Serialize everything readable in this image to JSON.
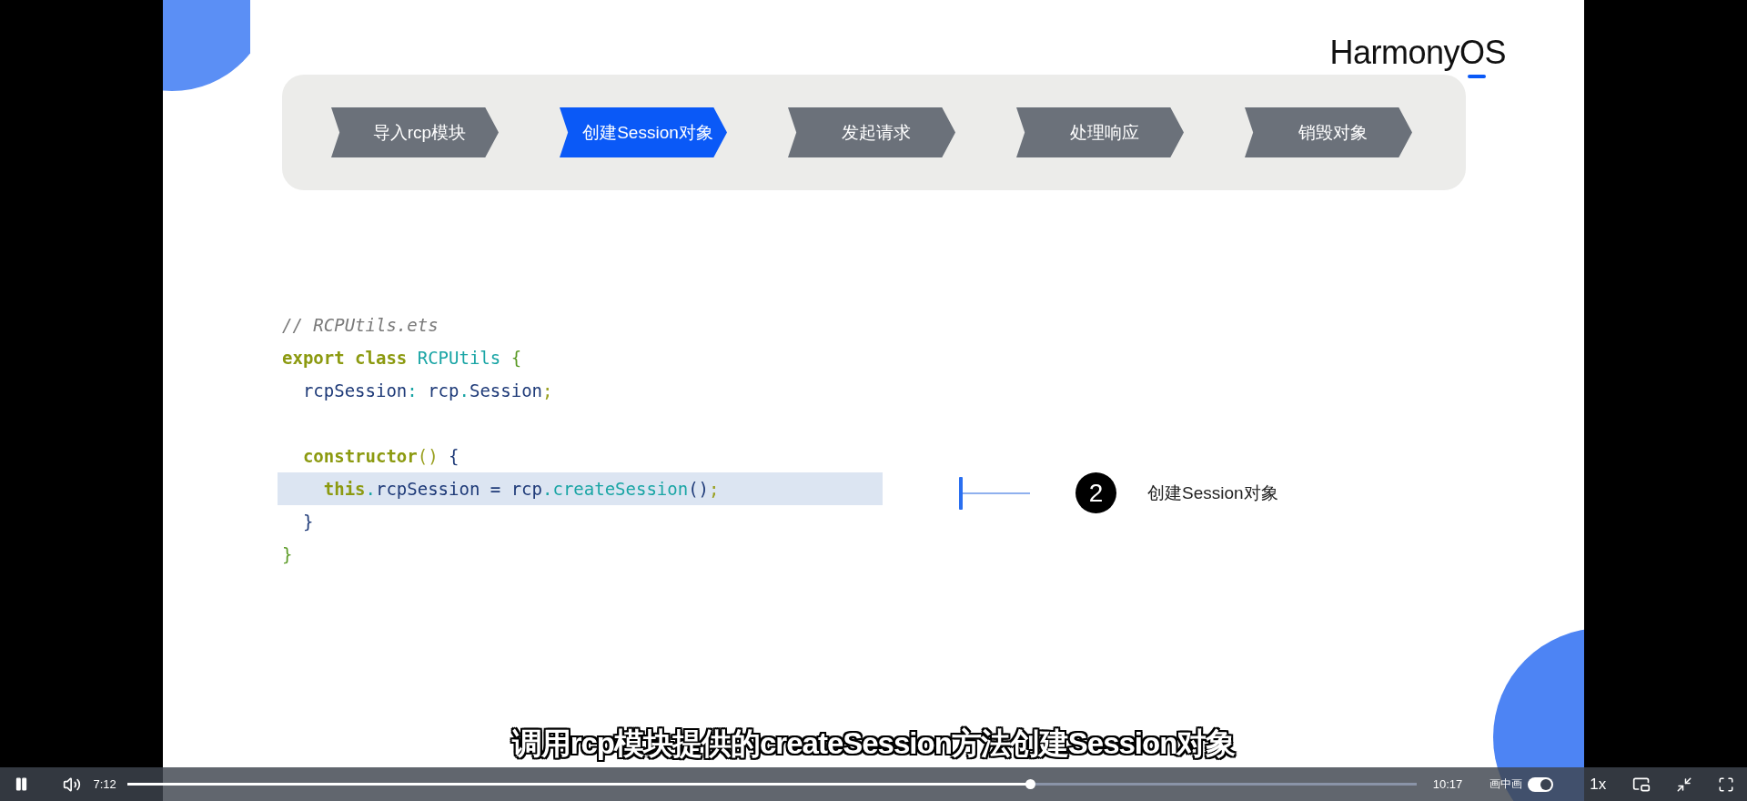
{
  "slide": {
    "logo": "HarmonyOS",
    "steps": [
      {
        "label": "导入rcp模块",
        "selected": false
      },
      {
        "label": "创建Session对象",
        "selected": true
      },
      {
        "label": "发起请求",
        "selected": false
      },
      {
        "label": "处理响应",
        "selected": false
      },
      {
        "label": "销毁对象",
        "selected": false
      }
    ],
    "code": {
      "lines": [
        {
          "highlighted": false,
          "tokens": [
            {
              "kind": "comment",
              "text": "// RCPUtils.ets"
            }
          ]
        },
        {
          "highlighted": false,
          "tokens": [
            {
              "kind": "keyword",
              "text": "export class "
            },
            {
              "kind": "type",
              "text": "RCPUtils "
            },
            {
              "kind": "brace",
              "text": "{"
            }
          ]
        },
        {
          "highlighted": false,
          "tokens": [
            {
              "kind": "ident",
              "text": "  rcpSession"
            },
            {
              "kind": "punct",
              "text": ": "
            },
            {
              "kind": "ident",
              "text": "rcp"
            },
            {
              "kind": "punct",
              "text": "."
            },
            {
              "kind": "ident",
              "text": "Session"
            },
            {
              "kind": "semi",
              "text": ";"
            }
          ]
        },
        {
          "highlighted": false
        },
        {
          "highlighted": false,
          "tokens": [
            {
              "kind": "keyword",
              "text": "  constructor"
            },
            {
              "kind": "semi",
              "text": "() "
            },
            {
              "kind": "ident",
              "text": "{"
            }
          ]
        },
        {
          "highlighted": true,
          "tokens": [
            {
              "kind": "keyword",
              "text": "    this"
            },
            {
              "kind": "punct",
              "text": "."
            },
            {
              "kind": "ident",
              "text": "rcpSession = rcp"
            },
            {
              "kind": "punct",
              "text": "."
            },
            {
              "kind": "type",
              "text": "createSession"
            },
            {
              "kind": "ident",
              "text": "()"
            },
            {
              "kind": "semi",
              "text": ";"
            }
          ]
        },
        {
          "highlighted": false,
          "tokens": [
            {
              "kind": "ident",
              "text": "  }"
            }
          ]
        },
        {
          "highlighted": false,
          "tokens": [
            {
              "kind": "brace",
              "text": "}"
            }
          ]
        }
      ]
    },
    "callout": {
      "number": "2",
      "label": "创建Session对象"
    }
  },
  "subtitle": "调用rcp模块提供的createSession方法创建Session对象",
  "player": {
    "playing": true,
    "current_time": "7:12",
    "duration": "10:17",
    "progress": {
      "level": 0.7
    },
    "pip_label": "画中画",
    "pip_toggle": {
      "on": true
    },
    "speed": "1x"
  }
}
